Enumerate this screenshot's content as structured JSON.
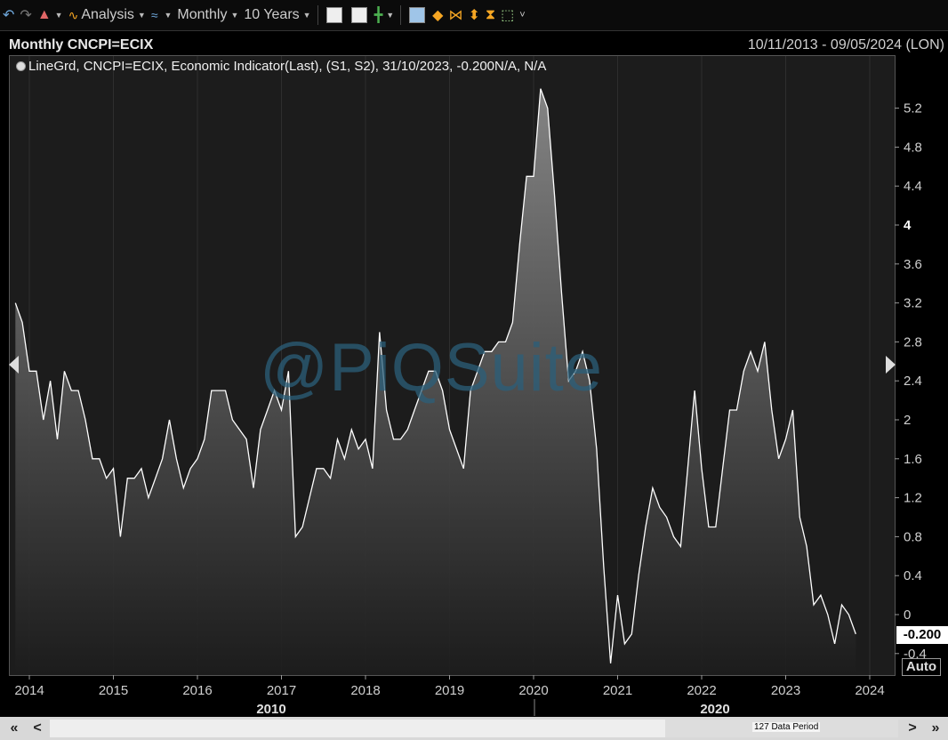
{
  "toolbar": {
    "analysis_label": "Analysis",
    "interval_label": "Monthly",
    "range_label": "10 Years"
  },
  "header": {
    "title": "Monthly CNCPI=ECIX",
    "date_range": "10/11/2013 - 09/05/2024 (LON)"
  },
  "legend": "LineGrd, CNCPI=ECIX, Economic Indicator(Last), (S1, S2), 31/10/2023, -0.200N/A, N/A",
  "watermark": "@PiQSuite",
  "last_value": "-0.200",
  "auto_label": "Auto",
  "nav": {
    "period_label": "127 Data Period",
    "first": "«",
    "prev": "<",
    "next": ">",
    "last": "»"
  },
  "chart_data": {
    "type": "area",
    "x_start": "2013-11",
    "x_end": "2023-10",
    "x_ticks": [
      "2014",
      "2015",
      "2016",
      "2017",
      "2018",
      "2019",
      "2020",
      "2021",
      "2022",
      "2023",
      "2024"
    ],
    "decade_labels": [
      "2010",
      "2020"
    ],
    "y_ticks": [
      "-0.4",
      "0",
      "0.4",
      "0.8",
      "1.2",
      "1.6",
      "2",
      "2.4",
      "2.8",
      "3.2",
      "3.6",
      "4",
      "4.4",
      "4.8",
      "5.2"
    ],
    "ylim": [
      -0.6,
      5.6
    ],
    "line_color": "#ffffff",
    "fill_color": "#777777",
    "values": [
      3.2,
      3.0,
      2.5,
      2.5,
      2.0,
      2.4,
      1.8,
      2.5,
      2.3,
      2.3,
      2.0,
      1.6,
      1.6,
      1.4,
      1.5,
      0.8,
      1.4,
      1.4,
      1.5,
      1.2,
      1.4,
      1.6,
      2.0,
      1.6,
      1.3,
      1.5,
      1.6,
      1.8,
      2.3,
      2.3,
      2.3,
      2.0,
      1.9,
      1.8,
      1.3,
      1.9,
      2.1,
      2.3,
      2.1,
      2.5,
      0.8,
      0.9,
      1.2,
      1.5,
      1.5,
      1.4,
      1.8,
      1.6,
      1.9,
      1.7,
      1.8,
      1.5,
      2.9,
      2.1,
      1.8,
      1.8,
      1.9,
      2.1,
      2.3,
      2.5,
      2.5,
      2.3,
      1.9,
      1.7,
      1.5,
      2.3,
      2.5,
      2.7,
      2.7,
      2.8,
      2.8,
      3.0,
      3.8,
      4.5,
      4.5,
      5.4,
      5.2,
      4.3,
      3.3,
      2.4,
      2.5,
      2.7,
      2.4,
      1.7,
      0.5,
      -0.5,
      0.2,
      -0.3,
      -0.2,
      0.4,
      0.9,
      1.3,
      1.1,
      1.0,
      0.8,
      0.7,
      1.5,
      2.3,
      1.5,
      0.9,
      0.9,
      1.5,
      2.1,
      2.1,
      2.5,
      2.7,
      2.5,
      2.8,
      2.1,
      1.6,
      1.8,
      2.1,
      1.0,
      0.7,
      0.1,
      0.2,
      0.0,
      -0.3,
      0.1,
      0.0,
      -0.2
    ]
  }
}
